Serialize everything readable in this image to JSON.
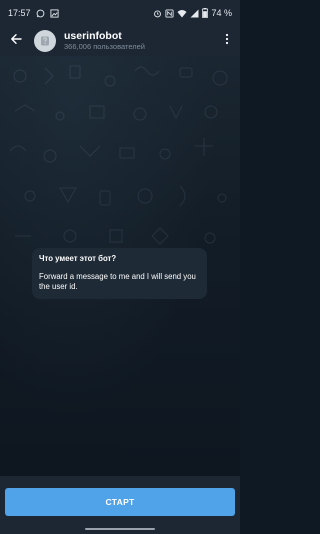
{
  "status_bar": {
    "time": "17:57",
    "battery": "74 %",
    "icons": [
      "whatsapp-icon",
      "image-icon",
      "alarm-icon",
      "nfc-icon",
      "wifi-icon",
      "signal-icon",
      "battery-icon"
    ]
  },
  "header": {
    "title": "userinfobot",
    "subtitle": "366,006 пользователей",
    "back_icon": "arrow-left-icon",
    "menu_icon": "more-vert-icon"
  },
  "bot_info": {
    "title": "Что умеет этот бот?",
    "description": "Forward a message to me and I will send you the user id."
  },
  "bottom": {
    "start_label": "СТАРТ"
  },
  "colors": {
    "topbar": "#1c2733",
    "accent": "#50a2e9",
    "bubble": "#1e2a36",
    "background": "#0f1923"
  }
}
